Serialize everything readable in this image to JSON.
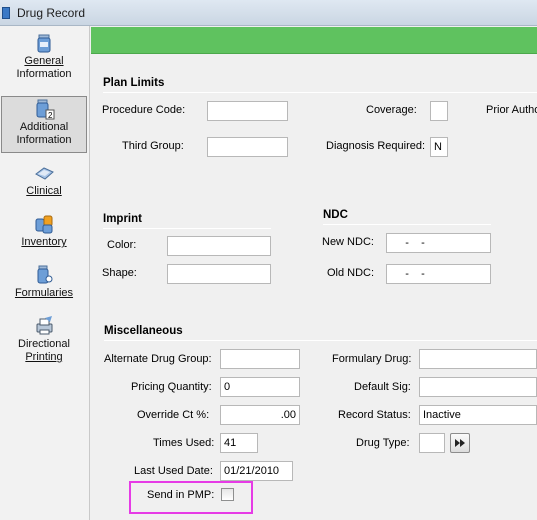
{
  "window": {
    "title": "Drug Record"
  },
  "sidebar": {
    "items": [
      {
        "label_line1": "General",
        "label_line2": "Information",
        "icon": "general-information-icon"
      },
      {
        "label_line1": "Additional",
        "label_line2": "Information",
        "icon": "additional-information-icon",
        "selected": true
      },
      {
        "label_line1": "Clinical",
        "icon": "clinical-icon"
      },
      {
        "label_line1": "Inventory",
        "icon": "inventory-icon"
      },
      {
        "label_line1": "Formularies",
        "icon": "formularies-icon"
      },
      {
        "label_line1": "Directional",
        "label_line2": "Printing",
        "icon": "directional-printing-icon"
      }
    ]
  },
  "plan_limits": {
    "heading": "Plan Limits",
    "procedure_code_label": "Procedure Code:",
    "procedure_code": "",
    "coverage_label": "Coverage:",
    "coverage": "",
    "prior_auth_label": "Prior Autho",
    "third_group_label": "Third Group:",
    "third_group": "",
    "diagnosis_required_label": "Diagnosis Required:",
    "diagnosis_required": "N"
  },
  "imprint": {
    "heading": "Imprint",
    "color_label": "Color:",
    "color": "",
    "shape_label": "Shape:",
    "shape": ""
  },
  "ndc": {
    "heading": "NDC",
    "new_ndc_label": "New NDC:",
    "new_ndc": "     -    -",
    "old_ndc_label": "Old NDC:",
    "old_ndc": "     -    -"
  },
  "misc": {
    "heading": "Miscellaneous",
    "alternate_drug_group_label": "Alternate Drug Group:",
    "alternate_drug_group": "",
    "formulary_drug_label": "Formulary Drug:",
    "formulary_drug": "",
    "pricing_quantity_label": "Pricing Quantity:",
    "pricing_quantity": "0",
    "default_sig_label": "Default Sig:",
    "default_sig": "",
    "override_ct_label": "Override Ct %:",
    "override_ct": ".00",
    "record_status_label": "Record Status:",
    "record_status": "Inactive",
    "times_used_label": "Times Used:",
    "times_used": "41",
    "drug_type_label": "Drug Type:",
    "drug_type": "",
    "last_used_date_label": "Last Used Date:",
    "last_used_date": "01/21/2010",
    "send_in_pmp_label": "Send in PMP:",
    "send_in_pmp_checked": false
  },
  "icons": {
    "drug_type_lookup": "fast-forward-icon"
  },
  "colors": {
    "header_bar": "#5fc25f",
    "highlight": "#e63be6"
  }
}
